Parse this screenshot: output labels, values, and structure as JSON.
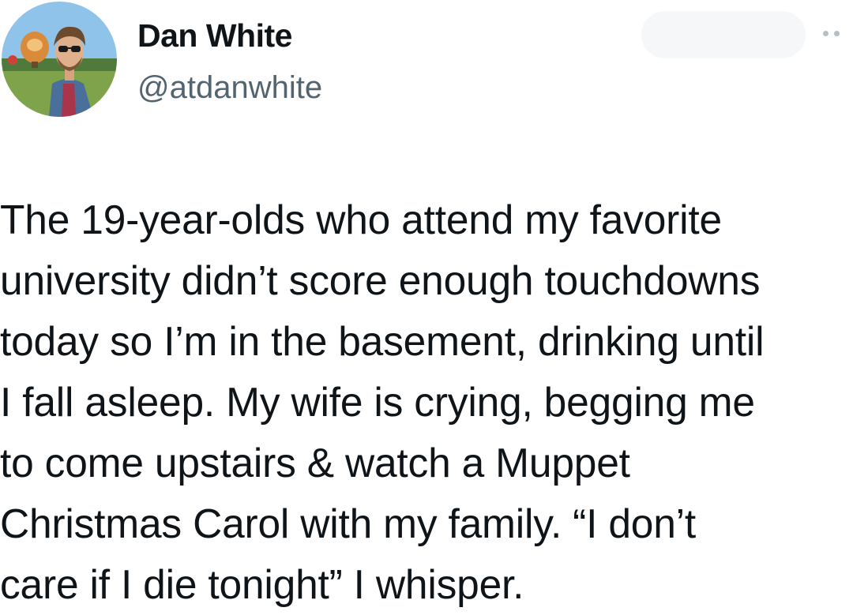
{
  "tweet": {
    "author": {
      "name": "Dan White",
      "handle": "@atdanwhite",
      "avatar_icon": "profile-photo"
    },
    "more_icon": "more-options-icon",
    "text_lines": [
      "The 19-year-olds who attend my favorite",
      "university didn’t score enough touchdowns",
      "today so I’m in the basement, drinking until",
      "I fall asleep. My wife is crying, begging me",
      "to come upstairs & watch a Muppet",
      "Christmas Carol with my family. “I don’t",
      "care if I die tonight” I whisper."
    ]
  },
  "colors": {
    "text": "#0f1419",
    "secondary": "#536471",
    "background": "#ffffff"
  }
}
